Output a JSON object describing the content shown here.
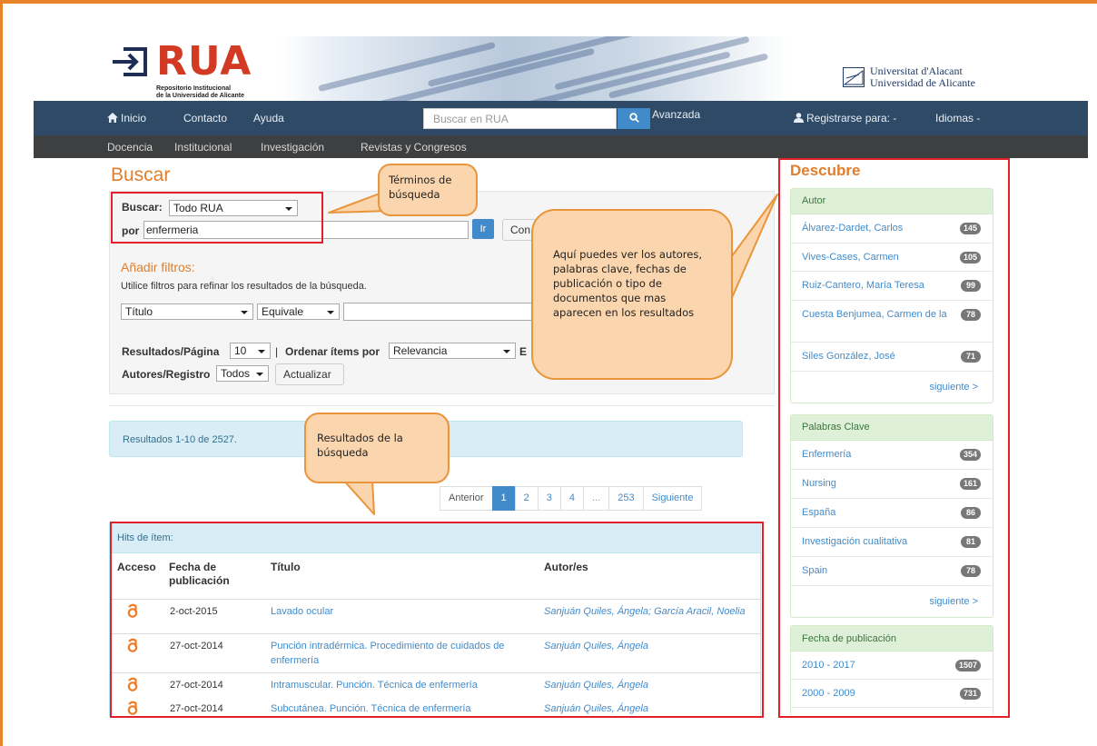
{
  "header": {
    "logo_word": "RUA",
    "logo_sub_1": "Repositorio Institucional",
    "logo_sub_2": "de la Universidad de Alicante",
    "university_1": "Universitat d'Alacant",
    "university_2": "Universidad de Alicante"
  },
  "nav": {
    "inicio": "Inicio",
    "contacto": "Contacto",
    "ayuda": "Ayuda",
    "search_placeholder": "Buscar en RUA",
    "search_button": "Q",
    "avanzada": "Avanzada",
    "registrarse": "Registrarse para: -",
    "idiomas": "Idiomas -"
  },
  "subnav": {
    "docencia": "Docencia",
    "institucional": "Institucional",
    "investigacion": "Investigación",
    "revistas": "Revistas y Congresos"
  },
  "search": {
    "title": "Buscar",
    "buscar_label": "Buscar:",
    "scope_value": "Todo RUA",
    "por_label": "por",
    "query_value": "enfermeria",
    "go_button": "Ir",
    "comparar_button": "Con",
    "filters_title": "Añadir filtros:",
    "filters_hint": "Utilice filtros para refinar los resultados de la búsqueda.",
    "filter_field": "Título",
    "filter_op": "Equivale",
    "rpp_label": "Resultados/Página",
    "rpp_value": "10",
    "sep": "|",
    "sort_label": "Ordenar ítems por",
    "sort_value": "Relevancia",
    "order_label": "E",
    "authors_label": "Autores/Registro",
    "authors_value": "Todos",
    "update_button": "Actualizar"
  },
  "results": {
    "summary": "Resultados 1-10 de 2527.",
    "pager": [
      "Anterior",
      "1",
      "2",
      "3",
      "4",
      "...",
      "253",
      "Siguiente"
    ],
    "hits_title": "Hits de ítem:",
    "columns": {
      "acceso": "Acceso",
      "fecha_1": "Fecha de",
      "fecha_2": "publicación",
      "titulo": "Título",
      "autores": "Autor/es"
    },
    "rows": [
      {
        "date": "2-oct-2015",
        "title": "Lavado ocular",
        "authors": "Sanjuán Quiles, Ángela; García Aracil, Noelia"
      },
      {
        "date": "27-oct-2014",
        "title": "Punción intradérmica. Procedimiento de cuidados de enfermería",
        "authors": "Sanjuán Quiles, Ángela"
      },
      {
        "date": "27-oct-2014",
        "title": "Intramuscular. Punción. Técnica de enfermería",
        "authors": "Sanjuán Quiles, Ángela"
      },
      {
        "date": "27-oct-2014",
        "title": "Subcutánea. Punción. Técnica de enfermería",
        "authors": "Sanjuán Quiles, Ángela"
      }
    ]
  },
  "discover": {
    "title": "Descubre",
    "autor": {
      "heading": "Autor",
      "items": [
        {
          "label": "Álvarez-Dardet, Carlos",
          "count": "145"
        },
        {
          "label": "Vives-Cases, Carmen",
          "count": "105"
        },
        {
          "label": "Ruiz-Cantero, María Teresa",
          "count": "99"
        },
        {
          "label": "Cuesta Benjumea, Carmen de la",
          "count": "78"
        },
        {
          "label": "Siles González, José",
          "count": "71"
        }
      ],
      "next": "siguiente >"
    },
    "palabras": {
      "heading": "Palabras Clave",
      "items": [
        {
          "label": "Enfermería",
          "count": "354"
        },
        {
          "label": "Nursing",
          "count": "161"
        },
        {
          "label": "España",
          "count": "86"
        },
        {
          "label": "Investigación cualitativa",
          "count": "81"
        },
        {
          "label": "Spain",
          "count": "78"
        }
      ],
      "next": "siguiente >"
    },
    "fecha": {
      "heading": "Fecha de publicación",
      "items": [
        {
          "label": "2010 - 2017",
          "count": "1507"
        },
        {
          "label": "2000 - 2009",
          "count": "731"
        }
      ]
    }
  },
  "callouts": {
    "terminos": "Términos de búsqueda",
    "aqui": "Aquí puedes ver los autores, palabras clave, fechas de publicación o tipo de documentos que mas aparecen en los resultados",
    "resultados": "Resultados de la búsqueda"
  },
  "colors": {
    "accent_orange": "#e27d2b",
    "nav_blue": "#2e4a66",
    "link_blue": "#428bca",
    "highlight_red": "#e0202a",
    "callout_fill": "#fbd5ad"
  }
}
